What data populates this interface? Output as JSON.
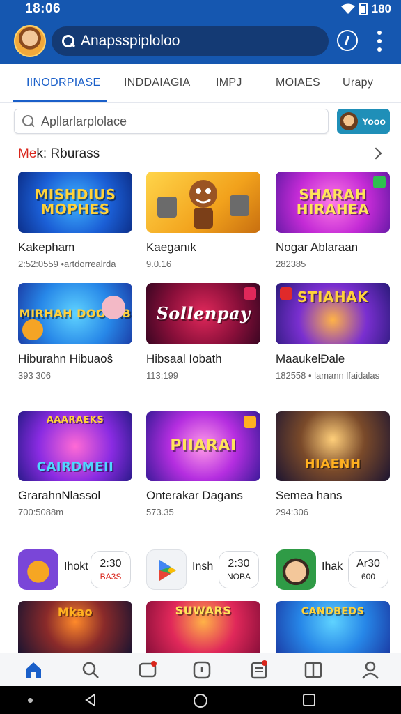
{
  "status": {
    "time": "18:06",
    "battery": "180"
  },
  "header": {
    "search_text": "Anapsspiploloo",
    "icons": [
      "avatar",
      "search-icon",
      "pin-icon",
      "more-vertical-icon"
    ]
  },
  "tabs": [
    {
      "label": "IINODRPIASE",
      "active": true
    },
    {
      "label": "INDDAIAGIA",
      "active": false
    },
    {
      "label": "IMPJ",
      "active": false
    },
    {
      "label": "MOIAES",
      "active": false
    },
    {
      "label": "Urapy",
      "active": false
    }
  ],
  "search2": {
    "placeholder": "Apllarlarplolace",
    "promo_label": "Yooo"
  },
  "section": {
    "title_red": "Me",
    "title_rest": "k: Rburass"
  },
  "games": [
    {
      "thumb_text": "MISHDIUS MOPHES",
      "name": "Kakepham",
      "meta": "2:52:0559 •artdorrealrda"
    },
    {
      "thumb_text": "",
      "name": "Kaeganık",
      "meta": "9.0.16"
    },
    {
      "thumb_text": "SHARAH HIRAHEA",
      "name": "Nogar Ablaraan",
      "meta": "282385"
    },
    {
      "thumb_text": "MIRHAH DOOLAB",
      "name": "Hiburahn Hibuaoŝ",
      "meta": "393 306"
    },
    {
      "thumb_text": "Sollenpay",
      "name": "Hibsaal Iobath",
      "meta": "113:199"
    },
    {
      "thumb_text": "STIAHAK",
      "name": "MaaukelÐale",
      "meta": "182558 • lamann lfaidalas"
    },
    {
      "thumb_text": "CAIRDMEII",
      "name": "GrarahnΝlassol",
      "meta": "700:5088m"
    },
    {
      "thumb_text": "PIIARAI",
      "name": "Onterakar Dagans",
      "meta": "573.35"
    },
    {
      "thumb_text": "HIAENH",
      "name": "Semea hans",
      "meta": "294:306"
    }
  ],
  "mini_apps": [
    {
      "name": "Ihokt",
      "box_line1": "2:30",
      "box_line2": "BA3S"
    },
    {
      "name": "Insh",
      "box_line1": "2:30",
      "box_line2": "NOBA"
    },
    {
      "name": "Ihak",
      "box_line1": "Ar30",
      "box_line2": "600"
    }
  ],
  "bottom_games": [
    {
      "thumb_text": "Mkao"
    },
    {
      "thumb_text": "SUWARS"
    },
    {
      "thumb_text": "CANDBEDS"
    }
  ],
  "bottom_nav": [
    "home-icon",
    "search-icon",
    "games-icon",
    "apps-icon",
    "list-icon",
    "book-icon",
    "profile-icon"
  ],
  "colors": {
    "brand_blue": "#1557b0",
    "accent_blue": "#1a5fc9",
    "accent_red": "#d9251b"
  }
}
